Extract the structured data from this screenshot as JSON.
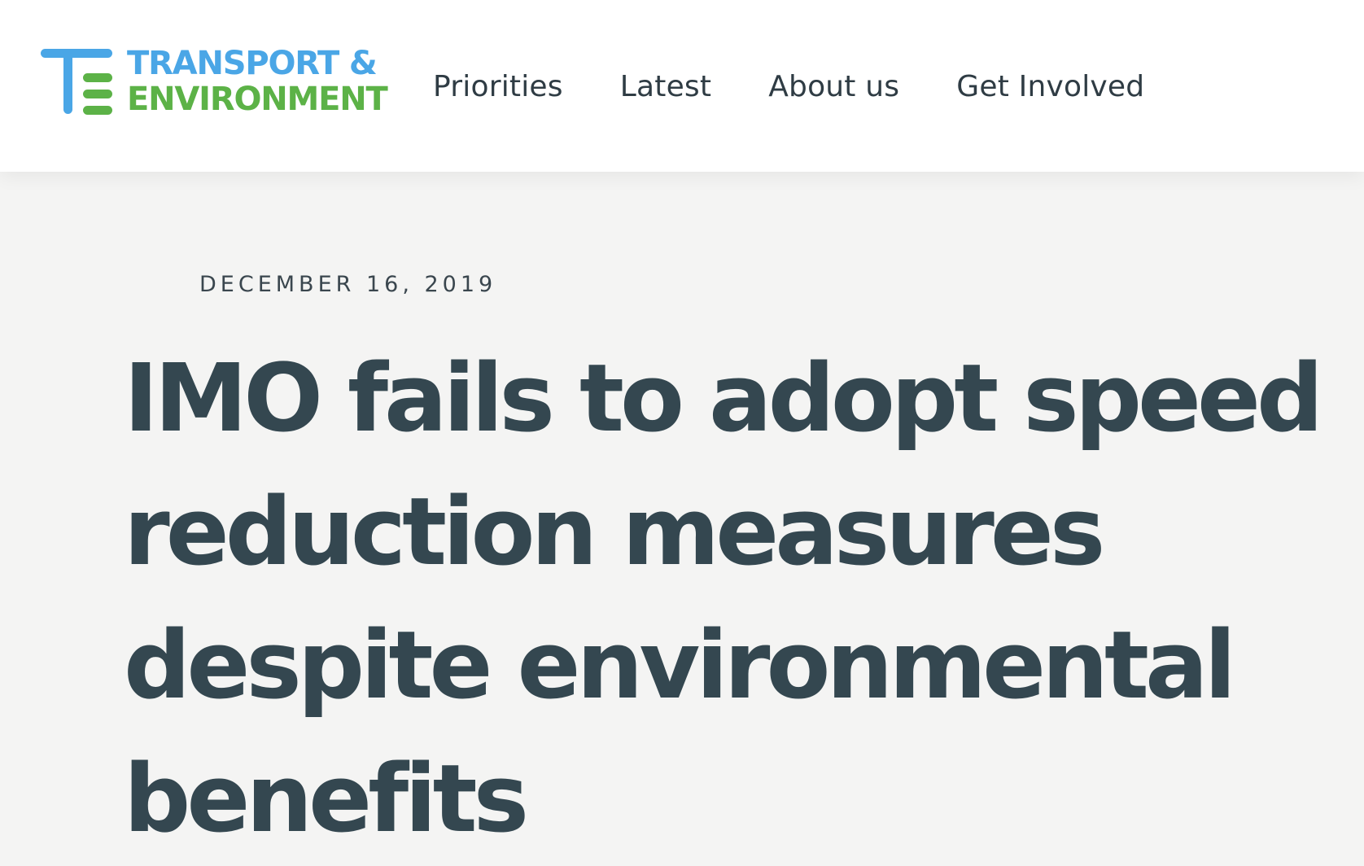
{
  "header": {
    "logo": {
      "line1": "TRANSPORT &",
      "line2": "ENVIRONMENT",
      "colors": {
        "blue": "#4aa6e6",
        "green": "#5cb247"
      }
    },
    "nav": {
      "items": [
        {
          "label": "Priorities"
        },
        {
          "label": "Latest"
        },
        {
          "label": "About us"
        },
        {
          "label": "Get Involved"
        }
      ]
    }
  },
  "article": {
    "date": "DECEMBER 16, 2019",
    "title": "IMO fails to adopt speed reduction measures despite environmental benefits"
  },
  "colors": {
    "header_bg": "#ffffff",
    "page_bg": "#f4f4f3",
    "text_dark": "#344750"
  }
}
